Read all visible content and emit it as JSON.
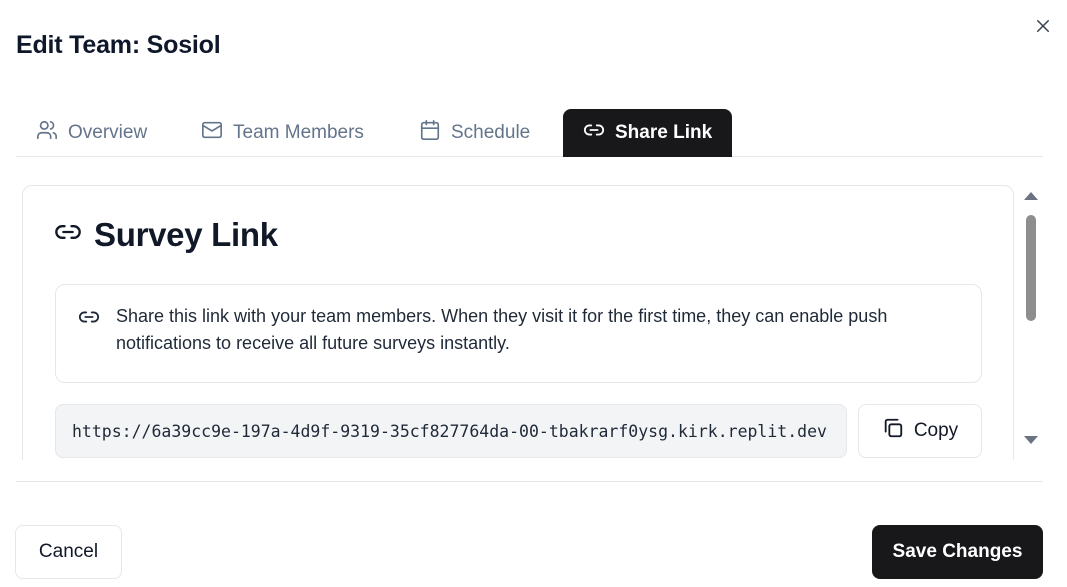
{
  "dialog": {
    "title": "Edit Team: Sosiol",
    "close_icon": "close-icon"
  },
  "tabs": [
    {
      "label": "Overview",
      "icon": "users-icon",
      "active": false
    },
    {
      "label": "Team Members",
      "icon": "mail-icon",
      "active": false
    },
    {
      "label": "Schedule",
      "icon": "calendar-icon",
      "active": false
    },
    {
      "label": "Share Link",
      "icon": "link-icon",
      "active": true
    }
  ],
  "card": {
    "title": "Survey Link",
    "title_icon": "link-icon",
    "info_icon": "link-icon",
    "info_text": "Share this link with your team members. When they visit it for the first time, they can enable push notifications to receive all future surveys instantly.",
    "url": "https://6a39cc9e-197a-4d9f-9319-35cf827764da-00-tbakrarf0ysg.kirk.replit.dev",
    "copy_label": "Copy",
    "copy_icon": "copy-icon"
  },
  "footer": {
    "cancel_label": "Cancel",
    "save_label": "Save Changes"
  },
  "colors": {
    "active_tab_bg": "#18181b",
    "primary_button_bg": "#18181b",
    "muted_text": "#64748b",
    "border": "#e5e7eb"
  }
}
